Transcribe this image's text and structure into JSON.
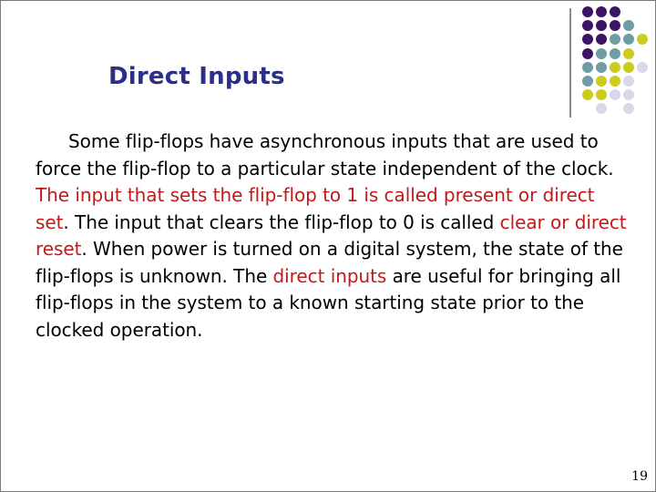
{
  "slide": {
    "title": "Direct Inputs",
    "paragraph": [
      {
        "text": "Some flip-flops have asynchronous inputs that are used to force the flip-flop to a particular state independent of the clock. ",
        "highlight": false
      },
      {
        "text": "The input that sets the flip-flop to 1 is called present or direct set",
        "highlight": true
      },
      {
        "text": ". The input that clears the flip-flop to 0 is called ",
        "highlight": false
      },
      {
        "text": "clear or direct reset",
        "highlight": true
      },
      {
        "text": ". When power is turned on a digital system, the state of the flip-flops is unknown. The ",
        "highlight": false
      },
      {
        "text": "direct inputs",
        "highlight": true
      },
      {
        "text": " are useful for bringing all flip-flops in the system to a known starting state prior to the clocked operation.",
        "highlight": false
      }
    ],
    "page_number": "19"
  },
  "colors": {
    "title": "#2b2f8a",
    "highlight": "#c01a1a",
    "purple": "#3b1466",
    "teal": "#6e9ea3",
    "yellow": "#cccc1e",
    "lavender": "#d8d8ea"
  },
  "decoration": {
    "dot_grid": [
      [
        "P",
        "P",
        "P",
        "",
        ""
      ],
      [
        "P",
        "P",
        "P",
        "T",
        ""
      ],
      [
        "P",
        "P",
        "T",
        "T",
        "Y"
      ],
      [
        "P",
        "T",
        "T",
        "Y",
        ""
      ],
      [
        "T",
        "T",
        "Y",
        "Y",
        "L"
      ],
      [
        "T",
        "Y",
        "Y",
        "L",
        ""
      ],
      [
        "Y",
        "Y",
        "L",
        "L",
        ""
      ],
      [
        "",
        "L",
        "",
        "L",
        ""
      ]
    ]
  }
}
